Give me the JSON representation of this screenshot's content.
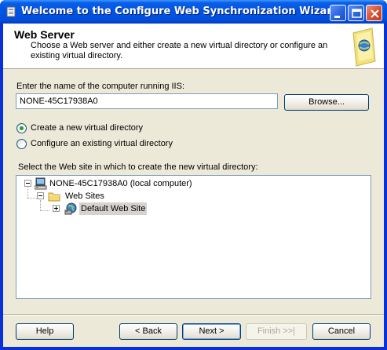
{
  "window": {
    "title": "Welcome to the Configure Web Synchronization Wizard"
  },
  "header": {
    "title": "Web Server",
    "description": "Choose a Web server and either create a new virtual directory or configure an existing virtual directory."
  },
  "computer": {
    "label": "Enter the name of the computer running IIS:",
    "value": "NONE-45C17938A0",
    "browse_label": "Browse..."
  },
  "options": [
    {
      "label": "Create a new virtual directory",
      "checked": true
    },
    {
      "label": "Configure an existing virtual directory",
      "checked": false
    }
  ],
  "site": {
    "label": "Select the Web site in which to create the new virtual directory:",
    "tree": [
      {
        "label": "NONE-45C17938A0 (local computer)",
        "icon": "computer-icon",
        "expanded": true
      },
      {
        "label": "Web Sites",
        "icon": "folder-icon",
        "expanded": true
      },
      {
        "label": "Default Web Site",
        "icon": "web-site-globe-icon",
        "expanded": false,
        "selected": true
      }
    ]
  },
  "buttons": {
    "help": "Help",
    "back": "< Back",
    "next": "Next >",
    "finish": "Finish >>|",
    "cancel": "Cancel"
  }
}
